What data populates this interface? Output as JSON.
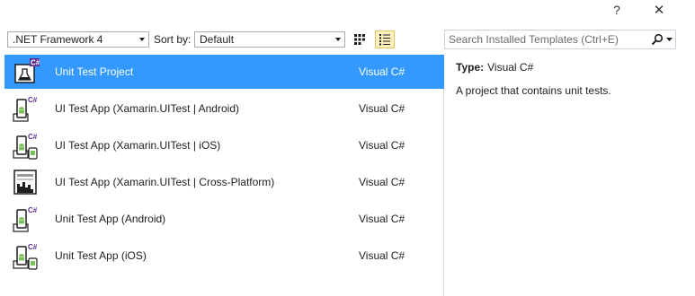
{
  "window": {
    "help_label": "?",
    "close_label": "✕"
  },
  "toolbar": {
    "framework_value": ".NET Framework 4",
    "sort_label": "Sort by:",
    "sort_value": "Default",
    "grid_view_icon": "grid-view-icon",
    "list_view_icon": "list-view-icon",
    "active_view": "list"
  },
  "search": {
    "placeholder": "Search Installed Templates (Ctrl+E)",
    "icon": "search-icon"
  },
  "templates": [
    {
      "name": "Unit Test Project",
      "language": "Visual C#",
      "icon": "unit-test-project-icon",
      "selected": true
    },
    {
      "name": "UI Test App (Xamarin.UITest | Android)",
      "language": "Visual C#",
      "icon": "android-app-icon",
      "selected": false
    },
    {
      "name": "UI Test App (Xamarin.UITest | iOS)",
      "language": "Visual C#",
      "icon": "ios-app-icon",
      "selected": false
    },
    {
      "name": "UI Test App (Xamarin.UITest | Cross-Platform)",
      "language": "Visual C#",
      "icon": "cross-platform-app-icon",
      "selected": false
    },
    {
      "name": "Unit Test App (Android)",
      "language": "Visual C#",
      "icon": "android-app-icon",
      "selected": false
    },
    {
      "name": "Unit Test App (iOS)",
      "language": "Visual C#",
      "icon": "ios-app-icon",
      "selected": false
    }
  ],
  "details": {
    "type_label": "Type:",
    "type_value": "Visual C#",
    "description": "A project that contains unit tests."
  },
  "colors": {
    "selection": "#3399ff",
    "android": "#78c257",
    "csharp_badge": "#5c2d91"
  }
}
